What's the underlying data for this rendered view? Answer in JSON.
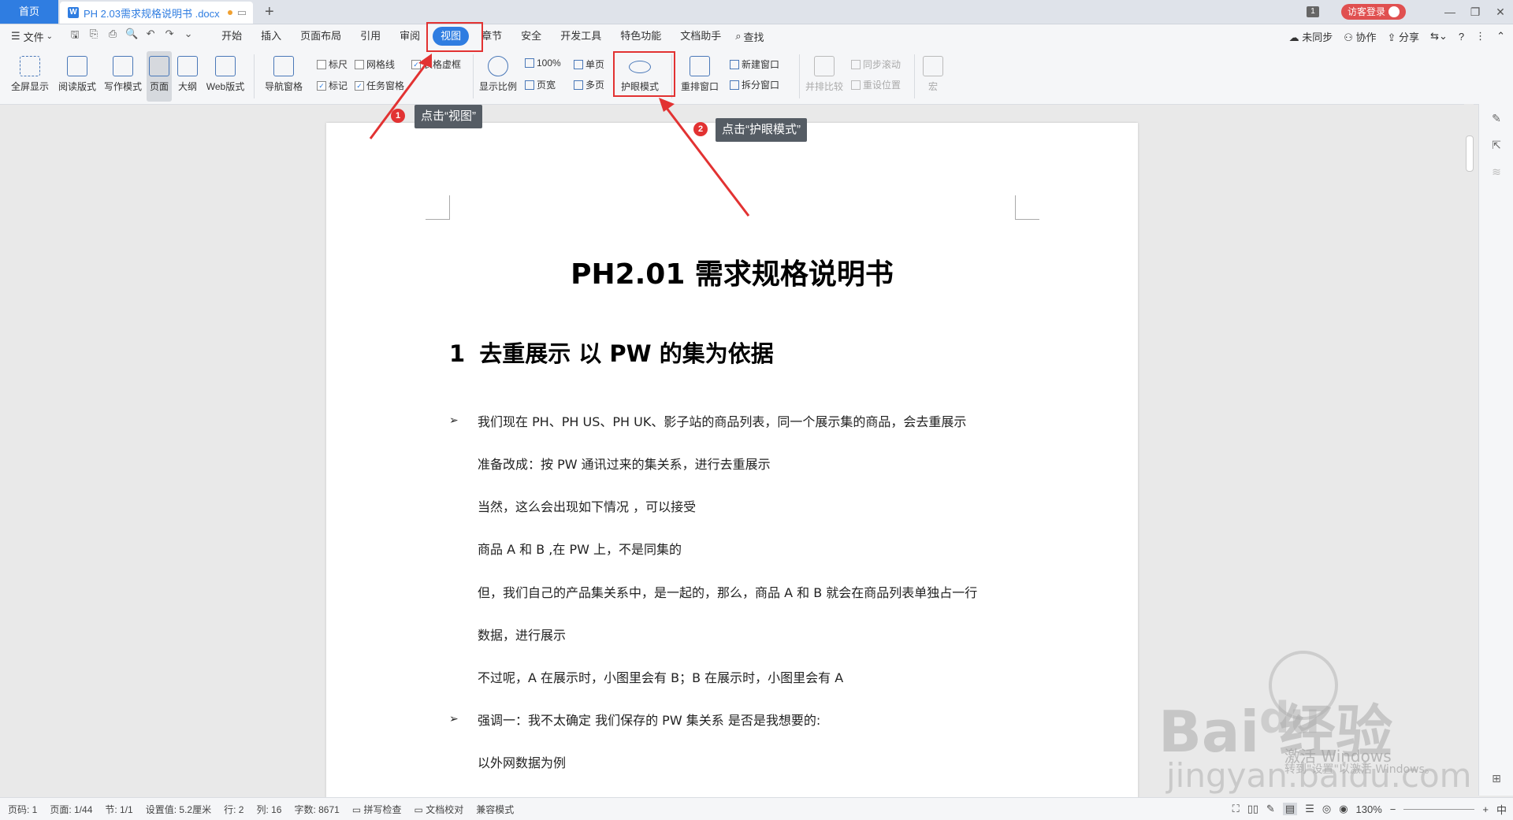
{
  "titlebar": {
    "home_tab": "首页",
    "doc_tab": "PH 2.03需求规格说明书 .docx",
    "new_tab": "+",
    "count_badge": "1",
    "login": "访客登录"
  },
  "menubar": {
    "file": "文件",
    "tabs": [
      "开始",
      "插入",
      "页面布局",
      "引用",
      "审阅",
      "视图",
      "章节",
      "安全",
      "开发工具",
      "特色功能",
      "文档助手"
    ],
    "active_tab": "视图",
    "search": "查找",
    "right": [
      "未同步",
      "协作",
      "分享"
    ]
  },
  "ribbon": {
    "fullscreen": "全屏显示",
    "reading": "阅读版式",
    "writing": "写作模式",
    "page": "页面",
    "outline": "大纲",
    "web": "Web版式",
    "nav_pane": "导航窗格",
    "ruler": "标尺",
    "gridlines": "网格线",
    "table_dashed": "表格虚框",
    "mark": "标记",
    "task_pane": "任务窗格",
    "zoom_ratio": "显示比例",
    "hundred": "100%",
    "page_width": "页宽",
    "single_page": "单页",
    "multi_page": "多页",
    "eye_mode": "护眼模式",
    "rearrange": "重排窗口",
    "new_window": "新建窗口",
    "split_window": "拆分窗口",
    "side_by_side": "并排比较",
    "sync_scroll": "同步滚动",
    "reset_pos": "重设位置",
    "macro": "宏"
  },
  "document": {
    "title": "PH2.01 需求规格说明书",
    "heading_num": "1",
    "heading_text": "去重展示  以  PW  的集为依据",
    "lines": [
      "我们现在 PH、PH US、PH UK、影子站的商品列表，同一个展示集的商品，会去重展示",
      "准备改成：按  PW 通讯过来的集关系，进行去重展示",
      "当然，这么会出现如下情况  ，可以接受",
      "商品 A 和 B ,在 PW 上，不是同集的",
      "但，我们自己的产品集关系中，是一起的，那么，商品 A 和 B 就会在商品列表单独占一行",
      "数据，进行展示",
      "不过呢，A 在展示时，小图里会有 B；B 在展示时，小图里会有 A",
      "强调一：我不太确定  我们保存的 PW 集关系  是否是我想要的:",
      "以外网数据为例"
    ]
  },
  "statusbar": {
    "page_num": "页码: 1",
    "page": "页面: 1/44",
    "section": "节: 1/1",
    "setting": "设置值: 5.2厘米",
    "row": "行: 2",
    "col": "列: 16",
    "words": "字数: 8671",
    "spell": "拼写检查",
    "proof": "文档校对",
    "compat": "兼容模式",
    "zoom": "130%",
    "ime": "中"
  },
  "annotations": {
    "step1_num": "1",
    "step1_text": "点击“视图”",
    "step2_num": "2",
    "step2_text": "点击“护眼模式”"
  },
  "watermark": {
    "brand": "Bai  经验",
    "brand_du": "du",
    "activate": "激活 Windows",
    "activate_sub": "转到\"设置\"以激活 Windows。",
    "url": "jingyan.baidu.com"
  },
  "colors": {
    "accent": "#2f7de1",
    "highlight": "#e23232",
    "callout": "#555c64"
  }
}
